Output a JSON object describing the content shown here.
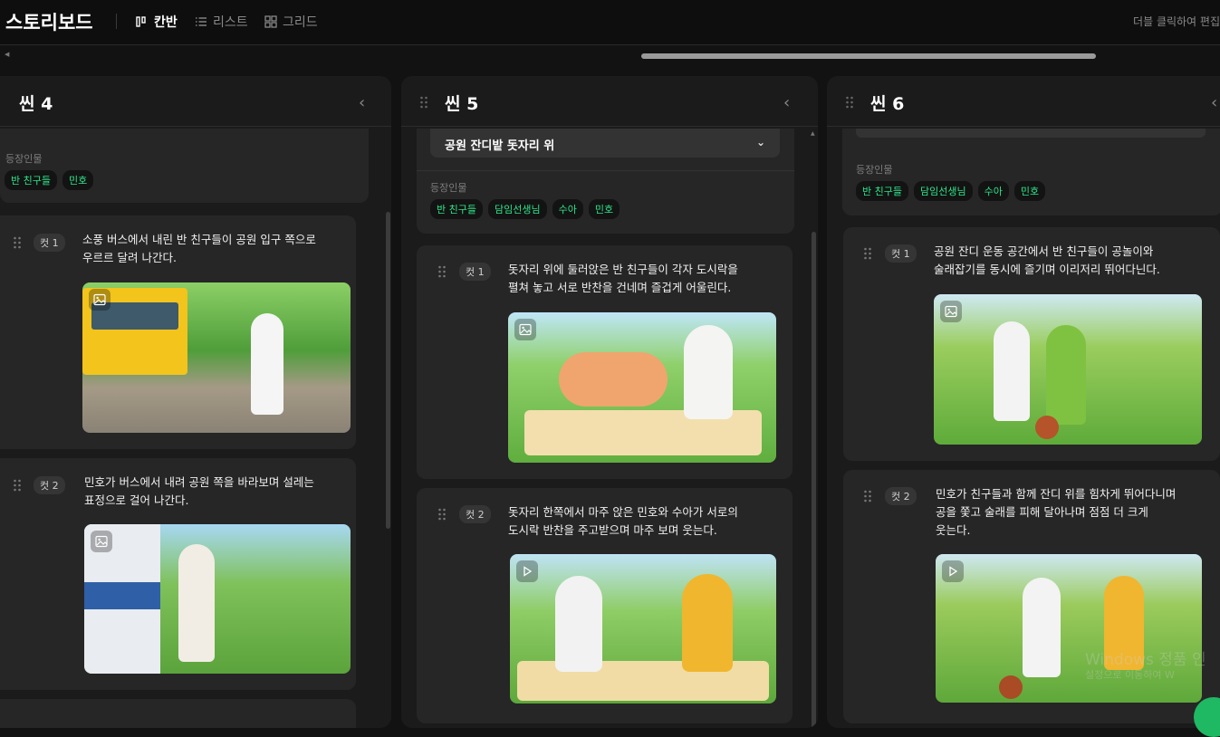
{
  "app": {
    "title": "스토리보드",
    "hint": "더블 클릭하여 편집"
  },
  "views": [
    {
      "label": "칸반",
      "icon": "kanban-icon",
      "active": true
    },
    {
      "label": "리스트",
      "icon": "list-icon",
      "active": false
    },
    {
      "label": "그리드",
      "icon": "grid-icon",
      "active": false
    }
  ],
  "scenes": [
    {
      "title": "씬 4",
      "cast_label": "등장인물",
      "characters": [
        "반 친구들",
        "민호"
      ],
      "shots": [
        {
          "badge": "컷 1",
          "line1": "소풍 버스에서 내린 반 친구들이 공원 입구 쪽으로",
          "line2": "우르르 달려 나간다.",
          "line3": "",
          "media": "image-icon"
        },
        {
          "badge": "컷 2",
          "line1": "민호가 버스에서 내려 공원 쪽을 바라보며 설레는",
          "line2": "표정으로 걸어 나간다.",
          "line3": "",
          "media": "image-icon"
        }
      ]
    },
    {
      "title": "씬 5",
      "location": "공원 잔디밭 돗자리 위",
      "cast_label": "등장인물",
      "characters": [
        "반 친구들",
        "담임선생님",
        "수아",
        "민호"
      ],
      "shots": [
        {
          "badge": "컷 1",
          "line1": "돗자리 위에 둘러앉은 반 친구들이 각자 도시락을",
          "line2": "펼쳐 놓고 서로 반찬을 건네며 즐겁게 어울린다.",
          "line3": "",
          "media": "image-icon"
        },
        {
          "badge": "컷 2",
          "line1": "돗자리 한쪽에서 마주 앉은 민호와 수아가 서로의",
          "line2": "도시락 반찬을 주고받으며 마주 보며 웃는다.",
          "line3": "",
          "media": "video-play-icon"
        }
      ]
    },
    {
      "title": "씬 6",
      "cast_label": "등장인물",
      "characters": [
        "반 친구들",
        "담임선생님",
        "수아",
        "민호"
      ],
      "shots": [
        {
          "badge": "컷 1",
          "line1": "공원 잔디 운동 공간에서 반 친구들이 공놀이와",
          "line2": "술래잡기를 동시에 즐기며 이리저리 뛰어다닌다.",
          "line3": "",
          "media": "image-icon"
        },
        {
          "badge": "컷 2",
          "line1": "민호가 친구들과 함께 잔디 위를 힘차게 뛰어다니며",
          "line2": "공을 쫓고 술래를 피해 달아나며 점점 더 크게",
          "line3": "웃는다.",
          "media": "video-play-icon"
        }
      ]
    }
  ],
  "overlay": {
    "watermark_line1": "Windows 정품 인",
    "watermark_line2": "설정으로 이동하여 W"
  },
  "colors": {
    "chip_text": "#2ee58a",
    "accent": "#1fb863",
    "background": "#121212",
    "card": "#262626"
  }
}
